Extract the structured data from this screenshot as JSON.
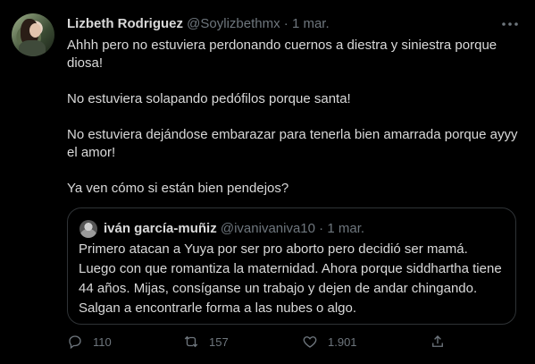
{
  "tweet": {
    "author_name": "Lizbeth Rodriguez",
    "handle": "@Soylizbethmx",
    "separator": "·",
    "date": "1 mar.",
    "paragraphs": [
      "Ahhh pero no estuviera perdonando cuernos a diestra y siniestra porque diosa!",
      "No estuviera solapando pedófilos porque santa!",
      "No estuviera dejándose embarazar para tenerla bien amarrada porque ayyy el amor!",
      "Ya ven cómo si están bien pendejos?"
    ]
  },
  "quoted": {
    "author_name": "iván garcía-muñiz",
    "handle": "@ivanivaniva10",
    "separator": "·",
    "date": "1 mar.",
    "text": "Primero atacan a Yuya por ser pro aborto pero decidió ser mamá. Luego con que romantiza la maternidad. Ahora porque siddhartha tiene 44 años. Mijas, consíganse un trabajo  y dejen de andar chingando. Salgan a encontrarle forma a las nubes o algo."
  },
  "actions": {
    "replies": "110",
    "retweets": "157",
    "likes": "1.901"
  },
  "icons": [
    "more-icon",
    "reply-icon",
    "retweet-icon",
    "like-icon",
    "share-icon"
  ],
  "colors": {
    "background": "#000000",
    "text": "#d9d9d9",
    "muted": "#6e767d",
    "border": "#2f3336"
  }
}
